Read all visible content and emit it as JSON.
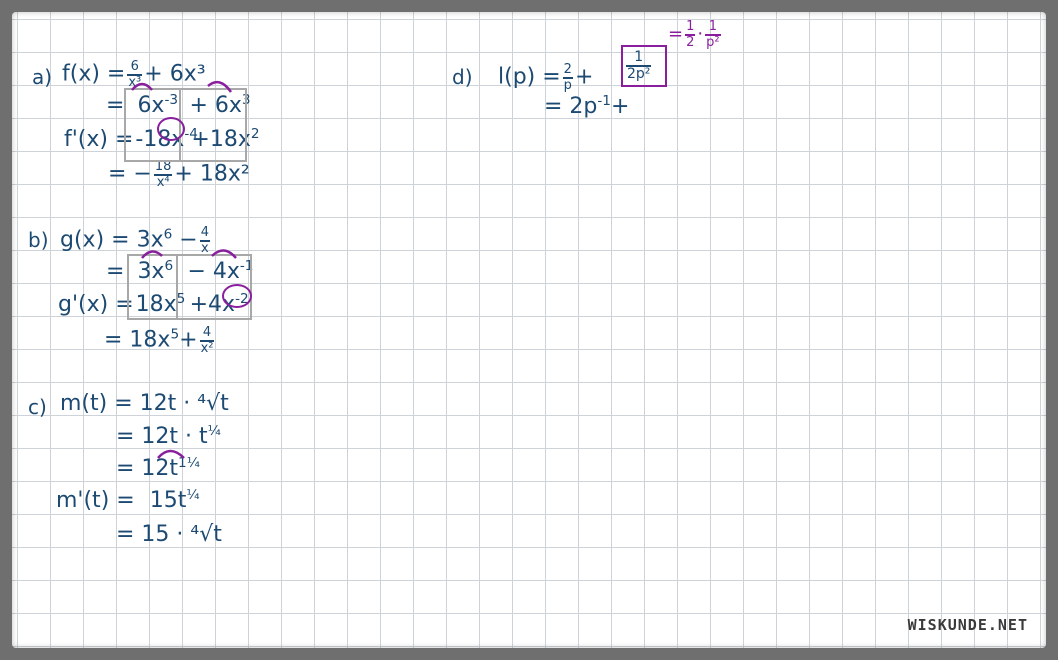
{
  "a": {
    "label": "a)",
    "l1_lhs": "f(x) =",
    "l1_num": "6",
    "l1_den": "x³",
    "l1_rest": "+ 6x³",
    "l2_eq": "=",
    "l2_t1": "6x",
    "l2_t1_exp": "-3",
    "l2_t2": "+ 6x",
    "l2_t2_exp": "3",
    "l3_lhs": "f'(x) =",
    "l3_t1": "-18x",
    "l3_t1_exp": "-4",
    "l3_t2": "+18x",
    "l3_t2_exp": "2",
    "l4_eq": "= −",
    "l4_num": "18",
    "l4_den": "x⁴",
    "l4_rest": "+ 18x²"
  },
  "b": {
    "label": "b)",
    "l1_lhs": "g(x) = 3x",
    "l1_exp": "6",
    "l1_minus": "−",
    "l1_num": "4",
    "l1_den": "x",
    "l2_eq": "=",
    "l2_t1": "3x",
    "l2_t1_exp": "6",
    "l2_t2": "− 4x",
    "l2_t2_exp": "-1",
    "l3_lhs": "g'(x) =",
    "l3_t1": "18x",
    "l3_t1_exp": "5",
    "l3_t2": "+4x",
    "l3_t2_exp": "-2",
    "l4_eq": "= 18x",
    "l4_exp": "5",
    "l4_plus": "+",
    "l4_num": "4",
    "l4_den": "x²"
  },
  "c": {
    "label": "c)",
    "l1": "m(t) =  12t · ⁴√t",
    "l2_base": "=  12t · t",
    "l2_exp": "¼",
    "l3_base": "=  12t",
    "l3_exp": "1¼",
    "l4_lhs": "m'(t) =",
    "l4_base": "15t",
    "l4_exp": "¼",
    "l5": "=  15 · ⁴√t"
  },
  "d": {
    "label": "d)",
    "l1_lhs": "l(p) =",
    "l1_num": "2",
    "l1_den": "p",
    "l1_plus": "+",
    "box_num": "1",
    "box_den": "2p²",
    "note_eq": "=",
    "note_num1": "1",
    "note_den1": "2",
    "note_dot": "·",
    "note_num2": "1",
    "note_den2": "p²",
    "l2_base": "= 2p",
    "l2_exp": "-1",
    "l2_plus": "+"
  },
  "watermark": "WISKUNDE.NET",
  "colors": {
    "ink": "#1c4a73",
    "accent": "#8a1f9e",
    "grid": "#cdd3d8"
  }
}
